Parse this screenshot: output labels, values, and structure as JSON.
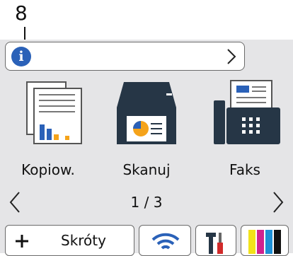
{
  "callout": {
    "number": "8"
  },
  "info_bar": {
    "icon": "info-icon",
    "chevron": "chevron-right-icon"
  },
  "tiles": [
    {
      "label": "Kopiow.",
      "icon": "copy-icon"
    },
    {
      "label": "Skanuj",
      "icon": "scan-icon"
    },
    {
      "label": "Faks",
      "icon": "fax-icon"
    }
  ],
  "pager": {
    "label": "1 / 3"
  },
  "bottom_bar": {
    "shortcuts_label": "Skróty",
    "icons": [
      "plus-icon",
      "wifi-icon",
      "tools-icon",
      "toner-icon"
    ]
  },
  "colors": {
    "screen_bg": "#e5e5e7",
    "accent_blue": "#2a61b8",
    "icon_dark": "#263646",
    "orange": "#f5a31a"
  }
}
